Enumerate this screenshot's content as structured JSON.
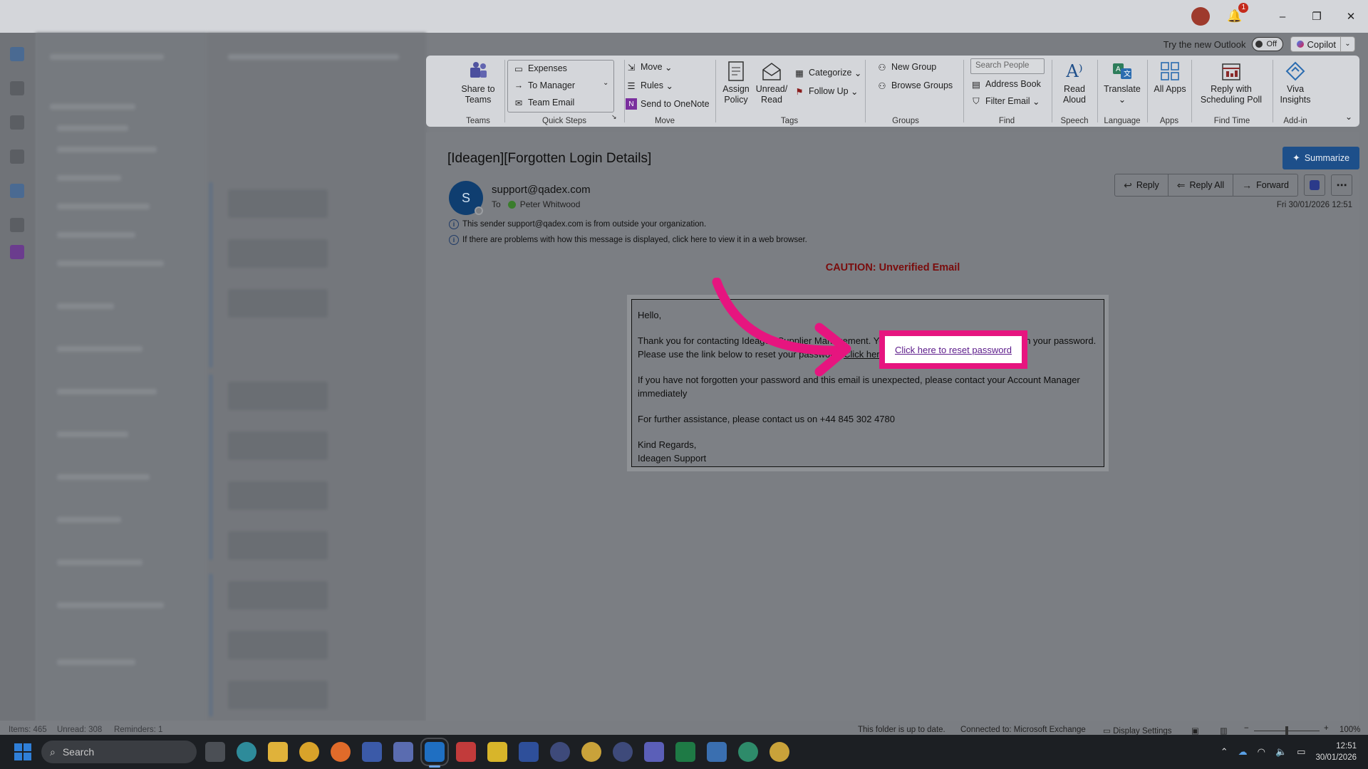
{
  "titlebar": {
    "notification_count": "1",
    "minimize": "–",
    "restore": "❐",
    "close": "✕"
  },
  "try_outlook": {
    "label": "Try the new Outlook",
    "toggle": "Off",
    "copilot": "Copilot"
  },
  "ribbon": {
    "teams": {
      "share_to_teams": "Share to Teams",
      "label": "Teams"
    },
    "quick_steps": {
      "items": [
        "Expenses",
        "To Manager",
        "Team Email"
      ],
      "label": "Quick Steps"
    },
    "move": {
      "move": "Move",
      "rules": "Rules",
      "onenote": "Send to OneNote",
      "label": "Move"
    },
    "tags": {
      "assign_policy": "Assign Policy",
      "unread_read": "Unread/ Read",
      "categorize": "Categorize",
      "follow_up": "Follow Up",
      "label": "Tags"
    },
    "groups": {
      "new_group": "New Group",
      "browse_groups": "Browse Groups",
      "label": "Groups"
    },
    "find": {
      "search_people": "Search People",
      "address_book": "Address Book",
      "filter_email": "Filter Email",
      "label": "Find"
    },
    "speech": {
      "read_aloud": "Read Aloud",
      "label": "Speech"
    },
    "language": {
      "translate": "Translate",
      "label": "Language"
    },
    "apps": {
      "all_apps": "All Apps",
      "label": "Apps"
    },
    "find_time": {
      "reply_poll": "Reply with Scheduling Poll",
      "label": "Find Time"
    },
    "addin": {
      "viva": "Viva Insights",
      "label": "Add-in"
    }
  },
  "message": {
    "subject": "[Ideagen][Forgotten Login Details]",
    "summarize": "Summarize",
    "sender_initial": "S",
    "sender": "support@qadex.com",
    "to_label": "To",
    "to": "Peter Whitwood",
    "actions": {
      "reply": "Reply",
      "reply_all": "Reply All",
      "forward": "Forward"
    },
    "datetime": "Fri 30/01/2026 12:51",
    "info1": "This sender support@qadex.com is from outside your organization.",
    "info2": "If there are problems with how this message is displayed, click here to view it in a web browser.",
    "caution": "CAUTION: Unverified Email",
    "body": {
      "greeting": "Hello,",
      "para1": "Thank you for contacting Ideagen Supplier Management. You have indicated you have forgotten your password. Please use the link below to reset your password:",
      "link": "Click here to reset password",
      "para2": "If you have not forgotten your password and this email is unexpected, please contact your Account Manager immediately",
      "para3": "For further assistance, please contact us on +44 845 302 4780",
      "signoff": "Kind Regards,",
      "signature": "Ideagen Support"
    }
  },
  "statusbar": {
    "items": "Items: 465",
    "unread": "Unread: 308",
    "reminders": "Reminders: 1",
    "folder_status": "This folder is up to date.",
    "connected": "Connected to: Microsoft Exchange",
    "display_settings": "Display Settings",
    "zoom": "100%"
  },
  "taskbar": {
    "search": "Search",
    "time": "12:51",
    "date": "30/01/2026"
  },
  "colors": {
    "highlight": "#e6157f",
    "caution": "#7a0c0c",
    "summarize": "#1d4f8a"
  }
}
